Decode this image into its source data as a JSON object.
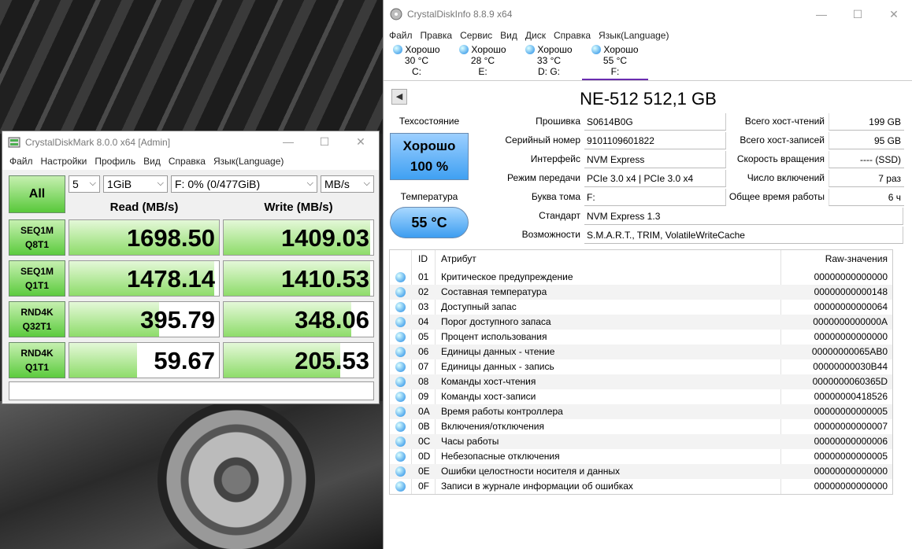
{
  "cdm": {
    "title": "CrystalDiskMark 8.0.0 x64 [Admin]",
    "menu": [
      "Файл",
      "Настройки",
      "Профиль",
      "Вид",
      "Справка",
      "Язык(Language)"
    ],
    "all_label": "All",
    "count": "5",
    "size": "1GiB",
    "drive": "F: 0% (0/477GiB)",
    "unit": "MB/s",
    "read_header": "Read (MB/s)",
    "write_header": "Write (MB/s)",
    "tests": [
      {
        "l1": "SEQ1M",
        "l2": "Q8T1",
        "read": "1698.50",
        "write": "1409.03",
        "read_frac": 1.0,
        "write_frac": 0.98
      },
      {
        "l1": "SEQ1M",
        "l2": "Q1T1",
        "read": "1478.14",
        "write": "1410.53",
        "read_frac": 0.97,
        "write_frac": 0.98
      },
      {
        "l1": "RND4K",
        "l2": "Q32T1",
        "read": "395.79",
        "write": "348.06",
        "read_frac": 0.6,
        "write_frac": 0.85
      },
      {
        "l1": "RND4K",
        "l2": "Q1T1",
        "read": "59.67",
        "write": "205.53",
        "read_frac": 0.45,
        "write_frac": 0.78
      }
    ],
    "comment": ""
  },
  "cdi": {
    "title": "CrystalDiskInfo 8.8.9 x64",
    "menu": [
      "Файл",
      "Правка",
      "Сервис",
      "Вид",
      "Диск",
      "Справка",
      "Язык(Language)"
    ],
    "disks": [
      {
        "status": "Хорошо",
        "temp": "30 °C",
        "letter": "C:"
      },
      {
        "status": "Хорошо",
        "temp": "28 °C",
        "letter": "E:"
      },
      {
        "status": "Хорошо",
        "temp": "33 °C",
        "letter": "D: G:"
      },
      {
        "status": "Хорошо",
        "temp": "55 °C",
        "letter": "F:"
      }
    ],
    "model": "NE-512 512,1 GB",
    "health_label": "Техсостояние",
    "health_status": "Хорошо",
    "health_percent": "100 %",
    "temp_label": "Температура",
    "temp_value": "55 °C",
    "info": {
      "firmware_label": "Прошивка",
      "firmware": "S0614B0G",
      "serial_label": "Серийный номер",
      "serial": "9101109601822",
      "interface_label": "Интерфейс",
      "interface": "NVM Express",
      "transfer_label": "Режим передачи",
      "transfer": "PCIe 3.0 x4 | PCIe 3.0 x4",
      "volume_label": "Буква тома",
      "volume": "F:",
      "standard_label": "Стандарт",
      "standard": "NVM Express 1.3",
      "features_label": "Возможности",
      "features": "S.M.A.R.T., TRIM, VolatileWriteCache",
      "reads_label": "Всего хост-чтений",
      "reads": "199 GB",
      "writes_label": "Всего хост-записей",
      "writes": "95 GB",
      "rotation_label": "Скорость вращения",
      "rotation": "---- (SSD)",
      "powercount_label": "Число включений",
      "powercount": "7 раз",
      "powerhours_label": "Общее время работы",
      "powerhours": "6 ч"
    },
    "smart_headers": {
      "id": "ID",
      "attr": "Атрибут",
      "raw": "Raw-значения"
    },
    "smart": [
      {
        "id": "01",
        "name": "Критическое предупреждение",
        "raw": "00000000000000"
      },
      {
        "id": "02",
        "name": "Составная температура",
        "raw": "00000000000148"
      },
      {
        "id": "03",
        "name": "Доступный запас",
        "raw": "00000000000064"
      },
      {
        "id": "04",
        "name": "Порог доступного запаса",
        "raw": "0000000000000A"
      },
      {
        "id": "05",
        "name": "Процент использования",
        "raw": "00000000000000"
      },
      {
        "id": "06",
        "name": "Единицы данных - чтение",
        "raw": "00000000065AB0"
      },
      {
        "id": "07",
        "name": "Единицы данных - запись",
        "raw": "00000000030B44"
      },
      {
        "id": "08",
        "name": "Команды хост-чтения",
        "raw": "0000000060365D"
      },
      {
        "id": "09",
        "name": "Команды хост-записи",
        "raw": "00000000418526"
      },
      {
        "id": "0A",
        "name": "Время работы контроллера",
        "raw": "00000000000005"
      },
      {
        "id": "0B",
        "name": "Включения/отключения",
        "raw": "00000000000007"
      },
      {
        "id": "0C",
        "name": "Часы работы",
        "raw": "00000000000006"
      },
      {
        "id": "0D",
        "name": "Небезопасные отключения",
        "raw": "00000000000005"
      },
      {
        "id": "0E",
        "name": "Ошибки целостности носителя и данных",
        "raw": "00000000000000"
      },
      {
        "id": "0F",
        "name": "Записи в журнале информации об ошибках",
        "raw": "00000000000000"
      }
    ]
  }
}
